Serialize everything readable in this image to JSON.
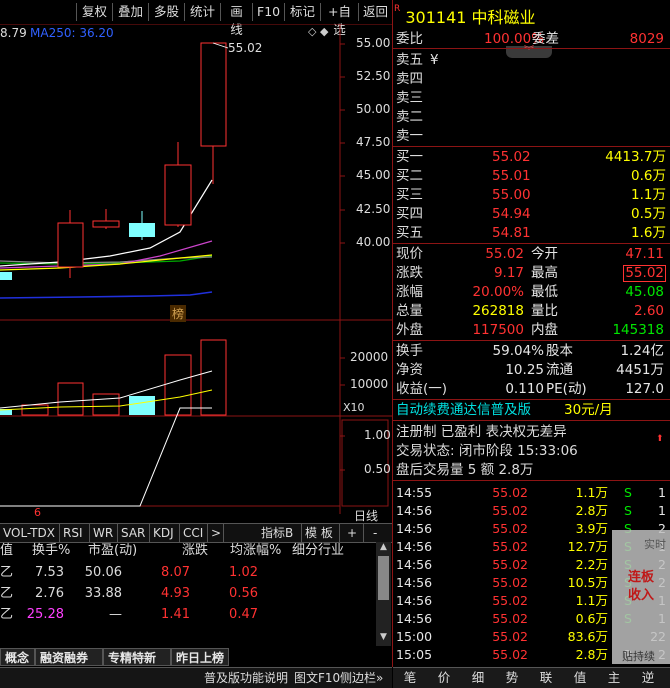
{
  "toolbar": {
    "top_left_label": "",
    "buttons": [
      "复权",
      "叠加",
      "多股",
      "统计",
      "画线",
      "F10",
      "标记",
      "+自选",
      "返回"
    ]
  },
  "chart": {
    "ma_text_prefix": "8.79",
    "ma250_text": "MA250: 36.20",
    "price_axis": [
      "55.00",
      "52.50",
      "50.00",
      "47.50",
      "45.00",
      "42.50",
      "40.00"
    ],
    "high_annotation": "55.02",
    "bang_label": "榜",
    "volume_axis": [
      "20000",
      "10000"
    ],
    "multiplier": "X10",
    "ind_axis": [
      "1.00",
      "0.50"
    ],
    "date_label": "6",
    "day_line_label": "日线"
  },
  "stock": {
    "flag": "R",
    "code": "301141",
    "name": "中科磁业",
    "weibi_label": "委比",
    "weibi_value": "100.00%",
    "weicha_label": "委差",
    "weicha_value": "8029",
    "sell": [
      {
        "label": "卖五",
        "mark": "¥"
      },
      {
        "label": "卖四",
        "mark": ""
      },
      {
        "label": "卖三",
        "mark": ""
      },
      {
        "label": "卖二",
        "mark": ""
      },
      {
        "label": "卖一",
        "mark": ""
      }
    ],
    "buy": [
      {
        "label": "买一",
        "price": "55.02",
        "vol": "4413.7万"
      },
      {
        "label": "买二",
        "price": "55.01",
        "vol": "0.6万"
      },
      {
        "label": "买三",
        "price": "55.00",
        "vol": "1.1万"
      },
      {
        "label": "买四",
        "price": "54.94",
        "vol": "0.5万"
      },
      {
        "label": "买五",
        "price": "54.81",
        "vol": "1.6万"
      }
    ],
    "quote": [
      {
        "l1": "现价",
        "v1": "55.02",
        "c1": "red",
        "l2": "今开",
        "v2": "47.11",
        "c2": "red"
      },
      {
        "l1": "涨跌",
        "v1": "9.17",
        "c1": "red",
        "l2": "最高",
        "v2": "55.02",
        "c2": "red"
      },
      {
        "l1": "涨幅",
        "v1": "20.00%",
        "c1": "red",
        "l2": "最低",
        "v2": "45.08",
        "c2": "green"
      },
      {
        "l1": "总量",
        "v1": "262818",
        "c1": "yellow",
        "l2": "量比",
        "v2": "2.60",
        "c2": "red"
      },
      {
        "l1": "外盘",
        "v1": "117500",
        "c1": "red",
        "l2": "内盘",
        "v2": "145318",
        "c2": "green"
      }
    ],
    "fund": [
      {
        "l1": "换手",
        "v1": "59.04%",
        "l2": "股本",
        "v2": "1.24亿"
      },
      {
        "l1": "净资",
        "v1": "10.25",
        "l2": "流通",
        "v2": "4451万"
      },
      {
        "l1": "收益(一)",
        "v1": "0.110",
        "l2": "PE(动)",
        "v2": "127.0"
      }
    ],
    "promo_text": "自动续费通达信普及版",
    "promo_price": "30元/月",
    "reg_text": "注册制 已盈利 表决权无差异",
    "trade_state": "交易状态: 闭市阶段 15:33:06",
    "after_volume": "盘后交易量 5 额 2.8万"
  },
  "ticks": [
    {
      "time": "14:55",
      "price": "55.02",
      "vol": "1.1万",
      "side": "S",
      "n": "1"
    },
    {
      "time": "14:56",
      "price": "55.02",
      "vol": "2.8万",
      "side": "S",
      "n": "1"
    },
    {
      "time": "14:56",
      "price": "55.02",
      "vol": "3.9万",
      "side": "S",
      "n": "2"
    },
    {
      "time": "14:56",
      "price": "55.02",
      "vol": "12.7万",
      "side": "S",
      "n": "1"
    },
    {
      "time": "14:56",
      "price": "55.02",
      "vol": "2.2万",
      "side": "S",
      "n": "2"
    },
    {
      "time": "14:56",
      "price": "55.02",
      "vol": "10.5万",
      "side": "S",
      "n": "2"
    },
    {
      "time": "14:56",
      "price": "55.02",
      "vol": "1.1万",
      "side": "S",
      "n": "1"
    },
    {
      "time": "14:56",
      "price": "55.02",
      "vol": "0.6万",
      "side": "S",
      "n": "1"
    },
    {
      "time": "15:00",
      "price": "55.02",
      "vol": "83.6万",
      "side": "",
      "n": "22"
    },
    {
      "time": "15:05",
      "price": "55.02",
      "vol": "2.8万",
      "side": "P",
      "n": "2"
    }
  ],
  "overlay_ad": {
    "line1": "实时",
    "line2": "连板",
    "line3": "收入",
    "line4": "贴持续"
  },
  "bottom_tabs": [
    "笔",
    "价",
    "细",
    "势",
    "联",
    "值",
    "主",
    "逆"
  ],
  "indicator_tabs": [
    "VOL-TDX",
    "RSI",
    "WR",
    "SAR",
    "KDJ",
    "CCI",
    ">",
    "指标B",
    "模 板",
    "+",
    "-"
  ],
  "table": {
    "headers": [
      "值",
      "换手%",
      "市盈(动)",
      "涨跌",
      "均涨幅%",
      "细分行业"
    ],
    "rows": [
      {
        "c0": "乙",
        "c1": "7.53",
        "c2": "50.06",
        "c3": "8.07",
        "c4": "1.02"
      },
      {
        "c0": "乙",
        "c1": "2.76",
        "c2": "33.88",
        "c3": "4.93",
        "c4": "0.56"
      },
      {
        "c0": "乙",
        "c1": "25.28",
        "c2": "—",
        "c3": "1.41",
        "c4": "0.47"
      }
    ]
  },
  "board_tabs": [
    "概念",
    "融资融券",
    "专精特新",
    "昨日上榜"
  ],
  "footer": {
    "b1": "普及版功能说明",
    "b2": "图文F10",
    "b3": "侧边栏»"
  }
}
